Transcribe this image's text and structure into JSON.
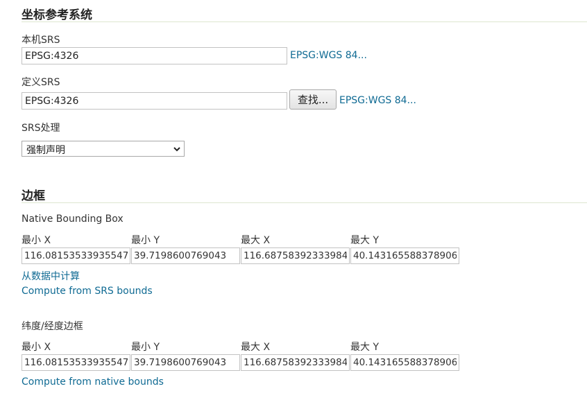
{
  "crs_section": {
    "title": "坐标参考系统",
    "native_srs": {
      "label": "本机SRS",
      "value": "EPSG:4326",
      "link": "EPSG:WGS 84..."
    },
    "declared_srs": {
      "label": "定义SRS",
      "value": "EPSG:4326",
      "find_button": "查找...",
      "link": "EPSG:WGS 84..."
    },
    "srs_handling": {
      "label": "SRS处理",
      "selected": "强制声明"
    }
  },
  "bbox_section": {
    "title": "边框",
    "native": {
      "label": "Native Bounding Box",
      "headers": [
        "最小 X",
        "最小 Y",
        "最大 X",
        "最大 Y"
      ],
      "values": [
        "116.08153533935547",
        "39.7198600769043",
        "116.68758392333984",
        "40.143165588378906"
      ],
      "compute_from_data": "从数据中计算",
      "compute_from_srs": "Compute from SRS bounds"
    },
    "latlon": {
      "label": "纬度/经度边框",
      "headers": [
        "最小 X",
        "最小 Y",
        "最大 X",
        "最大 Y"
      ],
      "values": [
        "116.08153533935547",
        "39.7198600769043",
        "116.68758392333984",
        "40.143165588378906"
      ],
      "compute_from_native": "Compute from native bounds"
    }
  },
  "colors": {
    "link": "#0f6a93",
    "section_rule": "#dde6cf"
  },
  "icons": {
    "select_arrow": "chevron-down-icon"
  }
}
